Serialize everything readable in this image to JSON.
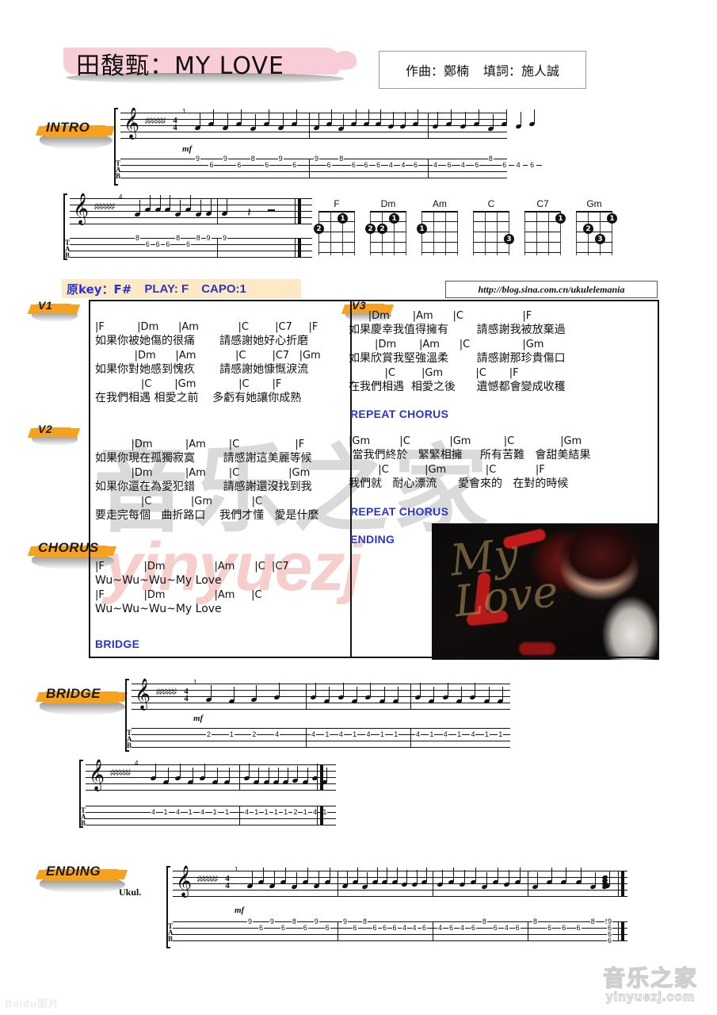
{
  "title": "田馥甄：MY LOVE",
  "credits": {
    "composer": "作曲：鄭楠",
    "lyricist": "填詞：施人誠"
  },
  "keybar": {
    "orig_key_label": "原key：F#",
    "play": "PLAY: F",
    "capo": "CAPO:1"
  },
  "url_banner": "http://blog.sina.com.cn/ukulelemania",
  "sections": {
    "intro": "INTRO",
    "bridge": "BRIDGE",
    "ending": "ENDING",
    "v1": "V1",
    "v2": "V2",
    "v3": "V3",
    "chorus": "CHORUS",
    "repeat_chorus": "REPEAT CHORUS",
    "bridge_blue": "BRIDGE",
    "ending_blue": "ENDING",
    "ukul": "Ukul."
  },
  "chord_diagrams": [
    {
      "name": "F",
      "dots": [
        {
          "string": 2,
          "fret": 1,
          "finger": "1"
        },
        {
          "string": 0,
          "fret": 2,
          "finger": "2"
        }
      ]
    },
    {
      "name": "Dm",
      "dots": [
        {
          "string": 2,
          "fret": 1,
          "finger": "1"
        },
        {
          "string": 0,
          "fret": 2,
          "finger": "2"
        },
        {
          "string": 1,
          "fret": 2,
          "finger": "2"
        }
      ]
    },
    {
      "name": "Am",
      "dots": [
        {
          "string": 0,
          "fret": 2,
          "finger": "1"
        }
      ]
    },
    {
      "name": "C",
      "dots": [
        {
          "string": 3,
          "fret": 3,
          "finger": "3"
        }
      ]
    },
    {
      "name": "C7",
      "dots": [
        {
          "string": 3,
          "fret": 1,
          "finger": "1"
        }
      ]
    },
    {
      "name": "Gm",
      "dots": [
        {
          "string": 3,
          "fret": 1,
          "finger": "1"
        },
        {
          "string": 1,
          "fret": 2,
          "finger": "2"
        },
        {
          "string": 2,
          "fret": 3,
          "finger": "3"
        }
      ]
    }
  ],
  "verses": {
    "v1": [
      {
        "chords": "|F          |Dm      |Am            |C        |C7     |F",
        "lyric": "如果你被她傷的很痛       請感謝她好心折磨"
      },
      {
        "chords": "            |Dm      |Am            |C        |C7   |Gm",
        "lyric": "如果你對她感到愧疚       請感謝她慷慨淚流"
      },
      {
        "chords": "              |C       |Gm             |C       |F",
        "lyric": "在我們相遇 相愛之前    多虧有她讓你成熟"
      }
    ],
    "v2": [
      {
        "chords": "           |Dm          |Am       |C                 |F",
        "lyric": "如果你現在孤獨寂寞        請感謝這美麗等候"
      },
      {
        "chords": "           |Dm          |Am       |C               |Gm",
        "lyric": "如果你還在為愛犯錯        請感謝還沒找到我"
      },
      {
        "chords": "              |C            |Gm            |C",
        "lyric": "要走完每個   曲折路口    我們才懂   愛是什麼"
      }
    ],
    "v3": [
      {
        "chords": "      |Dm       |Am      |C                  |F",
        "lyric": "如果慶幸我值得擁有        請感謝我被放棄過"
      },
      {
        "chords": "        |Dm       |Am      |C                |Gm",
        "lyric": "如果欣賞我堅強溫柔        請感謝那珍貴傷口"
      },
      {
        "chords": "           |C        |Gm          |C       |F",
        "lyric": "在我們相遇  相愛之後      遺憾都會變成收穫"
      }
    ],
    "chorus": [
      {
        "chords": "|F            |Dm               |Am      |C  |C7",
        "lyric": "Wu~Wu~Wu~My Love"
      },
      {
        "chords": "|F            |Dm               |Am     |C",
        "lyric": "Wu~Wu~Wu~My Love"
      }
    ],
    "bridge": [
      {
        "chords": "|Gm         |C            |Gm          |C              |Gm",
        "lyric": " 當我們終於   緊緊相擁     所有苦難   會甜美結果"
      },
      {
        "chords": "         |C           |Gm            |C            |F",
        "lyric": "我們就   耐心漂流      愛會來的   在對的時候"
      }
    ]
  },
  "tabs": {
    "intro_1": {
      "measures": [
        [
          "9",
          "6",
          "9",
          "6",
          "8",
          "6",
          "9",
          "6"
        ],
        [
          "9",
          "6",
          "8",
          "6",
          "6",
          "6",
          "4",
          "4",
          "6"
        ],
        [
          "4",
          "6",
          "4",
          "6",
          "8",
          "6",
          "4",
          "6"
        ]
      ]
    },
    "intro_2": {
      "measures": [
        [
          "8",
          "6",
          "6",
          "6",
          "8",
          "6",
          "8",
          "9"
        ],
        [
          "9"
        ]
      ]
    },
    "bridge_1": {
      "measures": [
        [
          "2",
          "1",
          "2",
          "4"
        ],
        [
          "4",
          "1",
          "4",
          "1",
          "4",
          "1",
          "1"
        ],
        [
          "4",
          "1",
          "4",
          "1",
          "4",
          "1",
          "1"
        ]
      ]
    },
    "bridge_2": {
      "measures": [
        [
          "4",
          "1",
          "4",
          "1",
          "4",
          "1",
          "1"
        ],
        [
          "4",
          "1",
          "1",
          "1",
          "1",
          "2",
          "1",
          "4",
          "1"
        ]
      ]
    },
    "ending": {
      "measures": [
        [
          "9",
          "6",
          "9",
          "6",
          "8",
          "6",
          "9",
          "6"
        ],
        [
          "9",
          "6",
          "8",
          "6",
          "6",
          "6",
          "4",
          "4",
          "6"
        ],
        [
          "4",
          "6",
          "4",
          "6",
          "8",
          "6",
          "4",
          "6"
        ],
        [
          "8",
          "6",
          "6",
          "6",
          "8",
          "9"
        ]
      ],
      "final_chord": [
        "9",
        "6",
        "6",
        "6"
      ]
    }
  },
  "dynamic": "mf",
  "watermarks": {
    "center_cn": "音乐之家",
    "center_en": "yinyuezj",
    "bottom_cn": "音乐之家",
    "bottom_en": "yinyuezj.com",
    "baidu": "Baidu图片"
  },
  "colors": {
    "highlight_orange": "#f6a21e",
    "title_pink": "#f9cdd8",
    "keybar_bg": "#fde9c4",
    "blue_label": "#2b36c8"
  }
}
